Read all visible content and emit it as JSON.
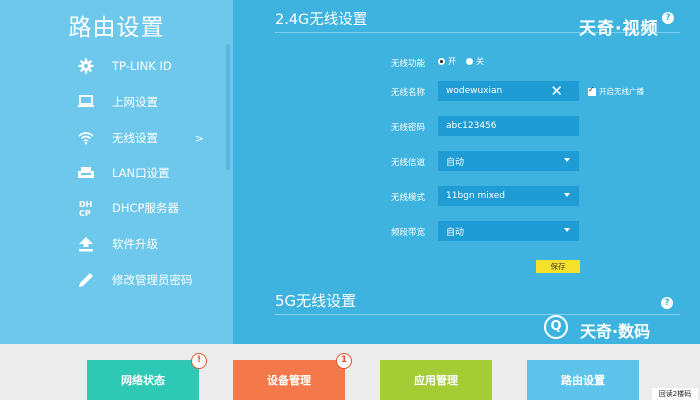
{
  "sidebar": {
    "title": "路由设置",
    "items": [
      {
        "label": "TP-LINK ID",
        "icon": "gear-icon"
      },
      {
        "label": "上网设置",
        "icon": "monitor-icon"
      },
      {
        "label": "无线设置",
        "icon": "wifi-icon",
        "chevron": ">"
      },
      {
        "label": "LAN口设置",
        "icon": "router-icon"
      },
      {
        "label": "DHCP服务器",
        "icon": "dhcp-icon",
        "icon_text": "DH\nCP"
      },
      {
        "label": "软件升级",
        "icon": "upload-icon"
      },
      {
        "label": "修改管理员密码",
        "icon": "pencil-icon"
      }
    ]
  },
  "wireless24": {
    "title": "2.4G无线设置",
    "enable_label": "无线功能",
    "on_label": "开",
    "off_label": "关",
    "ssid_label": "无线名称",
    "ssid_value": "wodewuxian",
    "broadcast_label": "开启无线广播",
    "password_label": "无线密码",
    "password_value": "abc123456",
    "channel_label": "无线信道",
    "channel_value": "自动",
    "mode_label": "无线模式",
    "mode_value": "11bgn mixed",
    "bandwidth_label": "频段带宽",
    "bandwidth_value": "自动",
    "save_label": "保存",
    "help": "?",
    "clear_glyph": "✕"
  },
  "wireless5": {
    "title": "5G无线设置",
    "help": "?"
  },
  "brand": {
    "top": "天奇·视频",
    "bottom": "天奇·数码",
    "bottom_icon": "Q"
  },
  "bottom_nav": {
    "tiles": [
      {
        "label": "网络状态",
        "color": "#2ec9b5",
        "badge": "!"
      },
      {
        "label": "设备管理",
        "color": "#f3794a",
        "badge": "1"
      },
      {
        "label": "应用管理",
        "color": "#a4cc35"
      },
      {
        "label": "路由设置",
        "color": "#5ec3ea"
      }
    ]
  },
  "qr_tag": "回读2楼码"
}
